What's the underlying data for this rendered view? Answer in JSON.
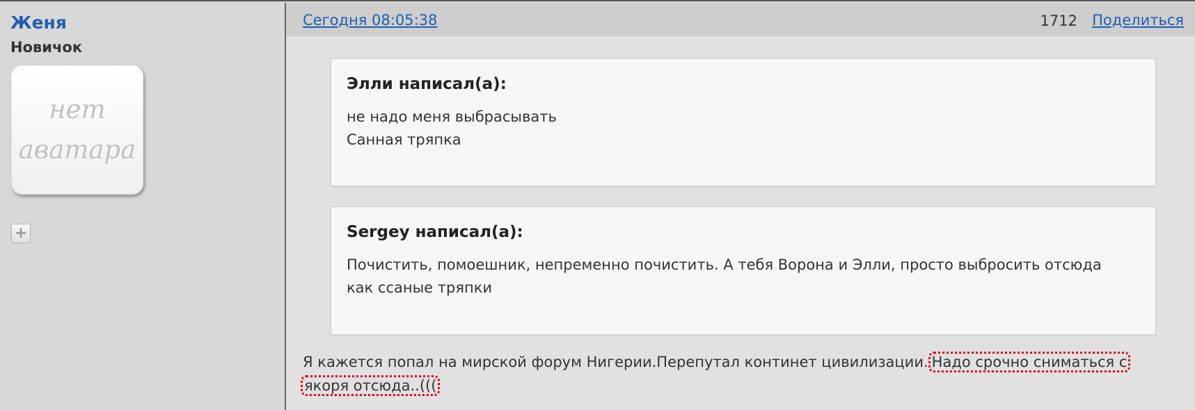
{
  "user": {
    "name": "Женя",
    "rank": "Новичок",
    "avatar_line1": "нет",
    "avatar_line2": "аватара",
    "plus_icon": "plus-icon"
  },
  "post_header": {
    "date": "Сегодня 08:05:38",
    "number": "1712",
    "share_label": "Поделиться"
  },
  "quotes": [
    {
      "author": "Элли написал(а):",
      "lines": [
        "не надо меня выбрасывать",
        "Санная тряпка"
      ]
    },
    {
      "author": "Sergey написал(а):",
      "lines": [
        "Почистить, помоешник, непременно почистить. А тебя Ворона и Элли, просто выбросить отсюда",
        "как ссаные тряпки"
      ]
    }
  ],
  "message": {
    "text_plain": "Я кажется попал на мирской форум Нигерии.Перепутал континет цивилизации.",
    "highlight_part1": "Надо срочно сниматься с",
    "highlight_part2": "якоря отсюда..((("
  },
  "colors": {
    "link": "#1f5fb0",
    "highlight_border": "#e0001a"
  }
}
